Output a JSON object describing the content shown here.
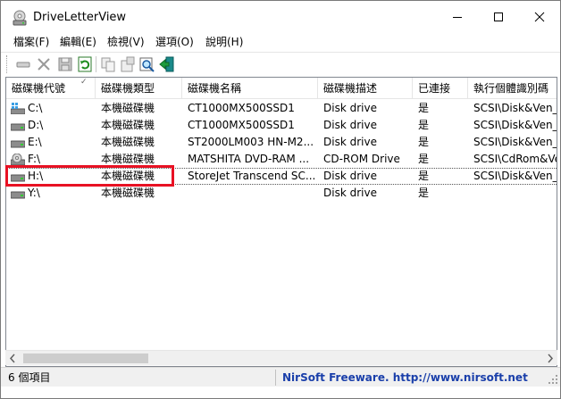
{
  "window": {
    "title": "DriveLetterView"
  },
  "menu": [
    {
      "label": "檔案(F)"
    },
    {
      "label": "編輯(E)"
    },
    {
      "label": "檢視(V)"
    },
    {
      "label": "選項(O)"
    },
    {
      "label": "說明(H)"
    }
  ],
  "toolbar": {
    "buttons": [
      {
        "icon": "drive-remove-icon"
      },
      {
        "icon": "delete-icon"
      },
      {
        "icon": "save-icon"
      },
      {
        "icon": "refresh-icon"
      },
      {
        "icon": "copy-icon"
      },
      {
        "icon": "properties-icon"
      },
      {
        "icon": "find-icon"
      },
      {
        "icon": "exit-icon"
      }
    ]
  },
  "table": {
    "columns": [
      {
        "label": "磁碟機代號",
        "sorted": true
      },
      {
        "label": "磁碟機類型"
      },
      {
        "label": "磁碟機名稱"
      },
      {
        "label": "磁碟機描述"
      },
      {
        "label": "已連接"
      },
      {
        "label": "執行個體識別碼"
      }
    ],
    "rows": [
      {
        "drive": "C:\\",
        "type": "本機磁碟機",
        "name": "CT1000MX500SSD1",
        "desc": "Disk drive",
        "connected": "是",
        "instance": "SCSI\\Disk&Ven_C",
        "icon": "system-drive-icon"
      },
      {
        "drive": "D:\\",
        "type": "本機磁碟機",
        "name": "CT1000MX500SSD1",
        "desc": "Disk drive",
        "connected": "是",
        "instance": "SCSI\\Disk&Ven_C",
        "icon": "hard-drive-icon"
      },
      {
        "drive": "E:\\",
        "type": "本機磁碟機",
        "name": "ST2000LM003 HN-M2...",
        "desc": "Disk drive",
        "connected": "是",
        "instance": "SCSI\\Disk&Ven_S",
        "icon": "hard-drive-icon"
      },
      {
        "drive": "F:\\",
        "type": "本機磁碟機",
        "name": "MATSHITA DVD-RAM ...",
        "desc": "CD-ROM Drive",
        "connected": "是",
        "instance": "SCSI\\CdRom&Ve",
        "icon": "cdrom-drive-icon"
      },
      {
        "drive": "H:\\",
        "type": "本機磁碟機",
        "name": "StoreJet Transcend SC...",
        "desc": "Disk drive",
        "connected": "是",
        "instance": "SCSI\\Disk&Ven_S",
        "icon": "hard-drive-icon"
      },
      {
        "drive": "Y:\\",
        "type": "本機磁碟機",
        "name": "",
        "desc": "Disk drive",
        "connected": "是",
        "instance": "",
        "icon": "hard-drive-icon"
      }
    ]
  },
  "status": {
    "count": "6 個項目",
    "link": "NirSoft Freeware.  http://www.nirsoft.net"
  },
  "colors": {
    "highlight": "#e81123",
    "link": "#1a3faa"
  }
}
